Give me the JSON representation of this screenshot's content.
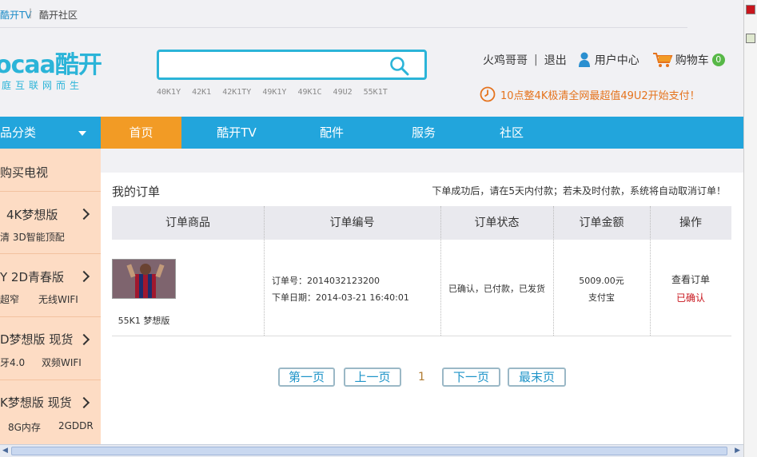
{
  "topbar": {
    "link_tv": "酷开TV",
    "separator": "|",
    "link_community": "酷开社区"
  },
  "logo": {
    "latin": "ocaa",
    "chinese": "酷开",
    "slogan": "庭互联网而生"
  },
  "search": {
    "value": "",
    "placeholder": "",
    "hot_words": [
      "40K1Y",
      "42K1",
      "42K1TY",
      "49K1Y",
      "49K1C",
      "49U2",
      "55K1T"
    ]
  },
  "user": {
    "name": "火鸡哥哥",
    "separator": "|",
    "logout": "退出",
    "center": "用户中心",
    "cart": "购物车",
    "cart_count": "0"
  },
  "promo": "10点整4K极清全网最超值49U2开始支付！",
  "nav": {
    "category": "品分类",
    "items": [
      "首页",
      "酷开TV",
      "配件",
      "服务",
      "社区"
    ],
    "active_index": 0
  },
  "sidebar": {
    "groups": [
      {
        "title": "购买电视",
        "sub": []
      },
      {
        "title": "4K梦想版",
        "sub": [
          "清 3D智能顶配"
        ]
      },
      {
        "title": "Y 2D青春版",
        "sub": [
          "超窄",
          "无线WIFI"
        ]
      },
      {
        "title": "D梦想版 现货",
        "sub": [
          "牙4.0",
          "双频WIFI"
        ]
      },
      {
        "title": "K梦想版 现货",
        "sub": [
          "8G内存",
          "2GDDR"
        ]
      }
    ]
  },
  "orders": {
    "title": "我的订单",
    "notice": "下单成功后，请在5天内付款；若未及时付款，系统将自动取消订单！",
    "columns": [
      "订单商品",
      "订单编号",
      "订单状态",
      "订单金额",
      "操作"
    ],
    "rows": [
      {
        "product": "55K1 梦想版",
        "order_no_label": "订单号：2014032123200",
        "order_date_label": "下单日期：2014-03-21 16:40:01",
        "status": "已确认，已付款，已发货",
        "amount": "5009.00元",
        "payment": "支付宝",
        "action": "查看订单",
        "action_status": "已确认"
      }
    ]
  },
  "pager": {
    "first": "第一页",
    "prev": "上一页",
    "current": "1",
    "next": "下一页",
    "last": "最末页"
  },
  "colors": {
    "brand": "#22a5dc",
    "active_nav": "#f29b25",
    "sidebar_bg": "#fddcc4",
    "promo": "#e5731d",
    "status_red": "#c8161d"
  }
}
